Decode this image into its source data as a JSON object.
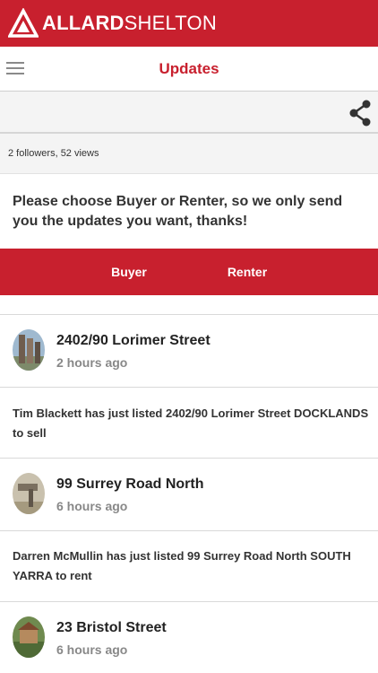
{
  "brand": {
    "name_bold": "ALLARD",
    "name_light": "SHELTON"
  },
  "navbar": {
    "title": "Updates"
  },
  "stats": {
    "text": "2 followers, 52 views"
  },
  "prompt": {
    "text": "Please choose Buyer or Renter, so we only send you the updates you want, thanks!"
  },
  "choices": {
    "buyer": "Buyer",
    "renter": "Renter"
  },
  "updates": [
    {
      "title": "2402/90 Lorimer Street",
      "time": "2 hours ago",
      "body": "Tim Blackett has just listed 2402/90 Lorimer Street DOCKLANDS to sell"
    },
    {
      "title": "99 Surrey Road North",
      "time": "6 hours ago",
      "body": "Darren McMullin has just listed 99 Surrey Road North SOUTH YARRA to rent"
    },
    {
      "title": "23 Bristol Street",
      "time": "6 hours ago"
    }
  ],
  "colors": {
    "brand_red": "#c8202e",
    "title_red": "#c8202e",
    "muted": "#888888"
  },
  "icons": [
    "allard-shelton-logo-icon",
    "hamburger-menu-icon",
    "share-icon"
  ]
}
